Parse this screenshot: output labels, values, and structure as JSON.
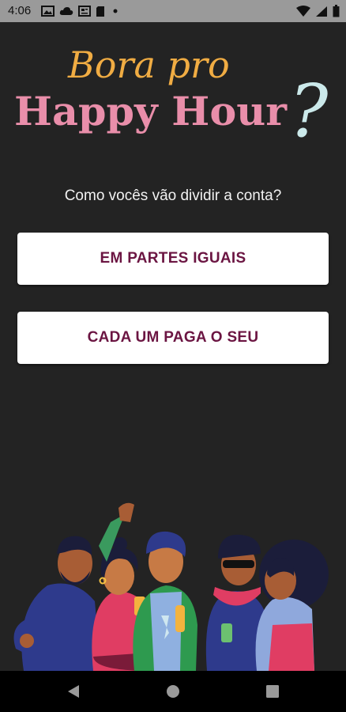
{
  "status_bar": {
    "time": "4:06",
    "left_icons": [
      "gallery-icon",
      "cloud-icon",
      "news-icon",
      "sd-card-icon",
      "dot-icon"
    ],
    "right_icons": [
      "wifi-icon",
      "signal-icon",
      "battery-icon"
    ]
  },
  "logo": {
    "line1": "Bora pro",
    "line2": "Happy Hour",
    "mark": "?",
    "colors": {
      "line1": "#f0ac43",
      "line2": "#e98eaa",
      "mark": "#cbe9ea"
    }
  },
  "prompt": {
    "text": "Como vocês vão dividir a conta?"
  },
  "options": {
    "equal_split": "EM PARTES IGUAIS",
    "each_pays": "CADA UM PAGA O SEU"
  },
  "theme": {
    "background": "#232323",
    "button_text": "#6b1542",
    "button_bg": "#ffffff"
  },
  "nav_bar": {
    "icons": [
      "back-icon",
      "home-icon",
      "recents-icon"
    ]
  }
}
